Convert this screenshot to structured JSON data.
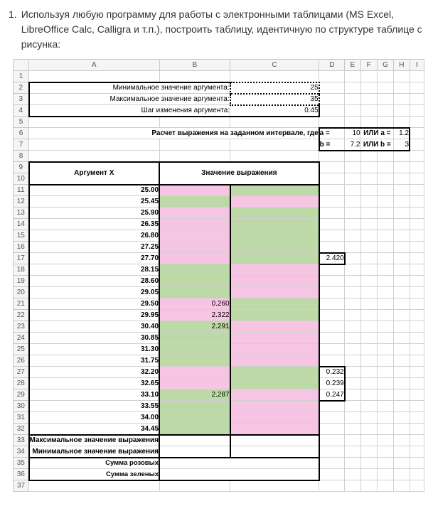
{
  "instruction_number": "1.",
  "instruction_text": "Используя любую программу для работы с электронными таблицами (MS Excel, LibreOffice Calc, Calligra и т.п.), построить таблицу, идентичную по структуре таблице с рисунка:",
  "columns": [
    "A",
    "B",
    "C",
    "D",
    "E",
    "F",
    "G",
    "H",
    "I"
  ],
  "labels": {
    "min_arg": "Минимальное значение аргумента:",
    "max_arg": "Максимальное значение аргумента:",
    "step_arg": "Шаг изменения аргумента:",
    "calc_title_prefix": "Расчет выражения на заданном интервале, где",
    "a_eq": "a =",
    "or_a_eq": "ИЛИ a =",
    "b_eq": "b =",
    "or_b_eq": "ИЛИ b =",
    "arg_header": "Аргумент Х",
    "val_header": "Значение выражения",
    "max_val_label": "Максимальное значение выражения",
    "min_val_label": "Минимальное значение выражения",
    "sum_pink": "Сумма розовых",
    "sum_green": "Сумма зеленых"
  },
  "params": {
    "min_arg": "25",
    "max_arg": "35",
    "step_arg": "0.45",
    "a1": "10",
    "a2": "1.2",
    "b1": "7.2",
    "b2": "3"
  },
  "rows": [
    {
      "n": 11,
      "x": "25.00",
      "b": "pink",
      "c": "green",
      "d": ""
    },
    {
      "n": 12,
      "x": "25.45",
      "b": "green",
      "c": "pink",
      "d": ""
    },
    {
      "n": 13,
      "x": "25.90",
      "b": "pink",
      "c": "green",
      "d": ""
    },
    {
      "n": 14,
      "x": "26.35",
      "b": "pink",
      "c": "green",
      "d": ""
    },
    {
      "n": 15,
      "x": "26.80",
      "b": "pink",
      "c": "green",
      "d": ""
    },
    {
      "n": 16,
      "x": "27.25",
      "b": "pink",
      "c": "green",
      "d": ""
    },
    {
      "n": 17,
      "x": "27.70",
      "b": "pink",
      "c": "green",
      "d": "2.420"
    },
    {
      "n": 18,
      "x": "28.15",
      "b": "green",
      "c": "pink",
      "d": ""
    },
    {
      "n": 19,
      "x": "28.60",
      "b": "green",
      "c": "pink",
      "d": ""
    },
    {
      "n": 20,
      "x": "29.05",
      "b": "green",
      "c": "pink",
      "d": ""
    },
    {
      "n": 21,
      "x": "29.50",
      "b": "pink",
      "bv": "0.260",
      "c": "green",
      "d": ""
    },
    {
      "n": 22,
      "x": "29.95",
      "b": "pink",
      "bv": "2.322",
      "c": "green",
      "d": ""
    },
    {
      "n": 23,
      "x": "30.40",
      "b": "green",
      "bv": "2.291",
      "c": "pink",
      "d": ""
    },
    {
      "n": 24,
      "x": "30.85",
      "b": "green",
      "c": "pink",
      "d": ""
    },
    {
      "n": 25,
      "x": "31.30",
      "b": "green",
      "c": "pink",
      "d": ""
    },
    {
      "n": 26,
      "x": "31.75",
      "b": "green",
      "c": "pink",
      "d": ""
    },
    {
      "n": 27,
      "x": "32.20",
      "b": "pink",
      "c": "green",
      "d": "0.232"
    },
    {
      "n": 28,
      "x": "32.65",
      "b": "pink",
      "c": "green",
      "d": "0.239"
    },
    {
      "n": 29,
      "x": "33.10",
      "b": "green",
      "bv": "2.287",
      "c": "pink",
      "d": "0.247"
    },
    {
      "n": 30,
      "x": "33.55",
      "b": "green",
      "c": "pink",
      "d": ""
    },
    {
      "n": 31,
      "x": "34.00",
      "b": "green",
      "c": "pink",
      "d": ""
    },
    {
      "n": 32,
      "x": "34.45",
      "b": "green",
      "c": "pink",
      "d": ""
    }
  ]
}
